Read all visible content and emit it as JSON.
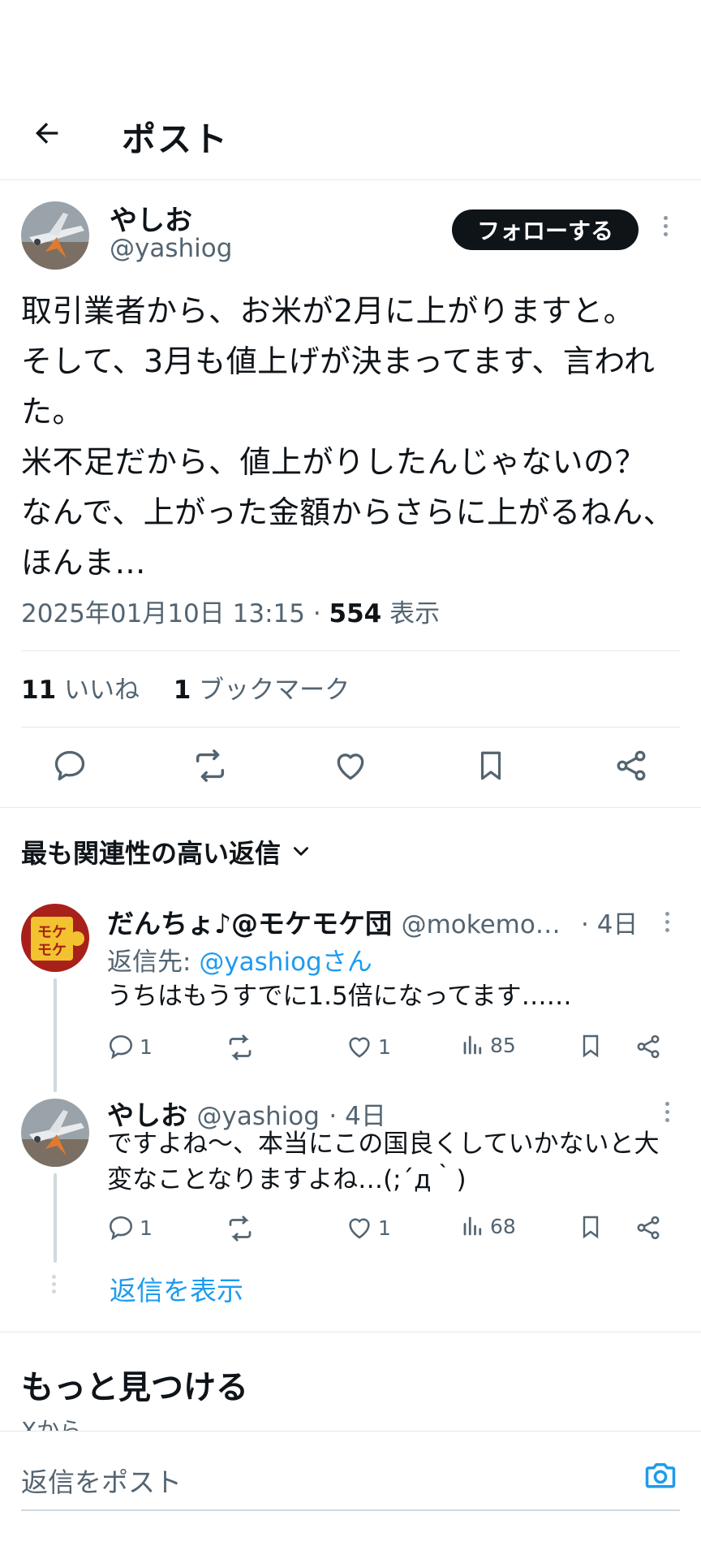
{
  "header": {
    "title": "ポスト"
  },
  "post": {
    "author_name": "やしお",
    "author_handle": "@yashiog",
    "follow_label": "フォローする",
    "text": "取引業者から、お米が2月に上がりますと。\nそして、3月も値上げが決まってます、言われた。\n米不足だから、値上がりしたんじゃないの？\nなんで、上がった金額からさらに上がるねん、ほんま…",
    "timestamp": "2025年01月10日 13:15",
    "separator": " · ",
    "views_count": "554",
    "views_label": "表示",
    "likes_count": "11",
    "likes_label": "いいね",
    "bookmarks_count": "1",
    "bookmarks_label": "ブックマーク"
  },
  "replies_section": {
    "sort_label": "最も関連性の高い返信"
  },
  "replies": [
    {
      "name": "だんちょ♪@モケモケ団",
      "handle": "@mokemo…",
      "time": "· 4日",
      "reply_to_prefix": "返信先: ",
      "reply_to_handle": "@yashiogさん",
      "text": "うちはもうすでに1.5倍になってます……",
      "replies": "1",
      "likes": "1",
      "views": "85",
      "avatar_text": "モケモケ"
    },
    {
      "name": "やしお",
      "handle": "@yashiog",
      "time": "· 4日",
      "text": "ですよね〜、本当にこの国良くしていかないと大変なことなりますよね…(;´д｀)",
      "replies": "1",
      "likes": "1",
      "views": "68"
    }
  ],
  "show_replies_label": "返信を表示",
  "discover": {
    "title": "もっと見つける",
    "subtitle": "Xから"
  },
  "composer": {
    "placeholder": "返信をポスト"
  },
  "icons": {
    "back": "arrow-left-icon",
    "reply": "speech-bubble-icon",
    "repost": "repost-icon",
    "like": "heart-icon",
    "bookmark": "bookmark-icon",
    "share": "share-icon",
    "views": "bar-chart-icon",
    "camera": "camera-icon"
  },
  "colors": {
    "accent": "#1d9bf0",
    "text": "#0f1419",
    "muted": "#536471"
  }
}
